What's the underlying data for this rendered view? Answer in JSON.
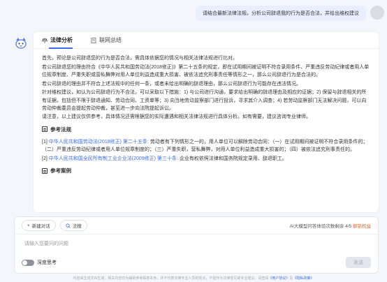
{
  "user_message": "请结合最新法律法规，分析公司辞退我的行为是否合法，并给出维权建议",
  "tabs": [
    {
      "label": "法律分析",
      "active": true
    },
    {
      "label": "联网总结",
      "active": false
    }
  ],
  "analysis": {
    "p1": "首先，预论是公司辞退您的行为是否合法，需具体依据您的情况与相关法律法规进行比对。",
    "p2_prefix": "若公司辞退您的理由符合",
    "p2_law": "《中华人民共和国劳动法(2018修正)》第二十五条",
    "p2_rest": "的规定，即在试用期间被证明不符合录用条件、严重违反劳动纪律或者用人单位规章制度、严重失职或营私舞弊对用人单位利益造成重大损害、被依法追究刑事责任等情形之一，那么公司辞退行为是合法的。",
    "p3": "若公司辞退的理由并不符合上述法规中的任何一条，或者未给出明确的辞退理由，那么公司辞退行为可能存在违法情况。",
    "p4": "针对维权建议，如认为公司辞退行为不合法，可以采取以下措施：1) 与公司进行沟通，要求给出明确的辞退理由及相应的证据；2) 保留与辞退相关的所有证据，包括但不限于辞退通知、劳动合同、工资单等；3) 向当地劳动监察部门进行投诉，寻求其介入调查；4) 若劳动监察部门无法解决问题，可以向劳动仲裁委员会提起劳动仲裁，甚至进一步向法院提起诉讼。",
    "p5": "请注意，以上建议仅供参考，具体情况还需根据您的实际遭遇和相关法律法规进行具体分析。如有需要，建议咨询专业律师。"
  },
  "references": {
    "title": "参考法规",
    "items": [
      {
        "index": "[1]",
        "law": "中华人民共和国劳动法(2018修正) 第二十五条:",
        "text": "劳动者有下列情形之一的，用人单位可以解除劳动合同：（一）在试用期间被证明不符合录用条件的；（二）严重违反劳动纪律或者用人单位规章制度的；（三）严重失职，营私舞弊，对用人单位利益造成重大损害的；（四）被依法追究刑事责任的。"
      },
      {
        "index": "[2]",
        "law": "中华人民共和国全民所有制工业企业法(2009修正) 第三十条:",
        "text": "企业有权依照法律和国务院规定录用、辞退职工。"
      }
    ]
  },
  "cases_title": "参考案例",
  "toolbar": {
    "new_chat": "新建对话",
    "regulations": "法搜",
    "quota_label": "AI大模型问答体验次数剩余 4/5",
    "quota_link": "解锁权益"
  },
  "input": {
    "placeholder": "请输入您要问的问题"
  },
  "deep_think_label": "深度思考",
  "send_label": "发送",
  "disclaimer": {
    "text": "内容由生成式AI生成，相关内容仅为辅助参考解答本身，并不代表法律专业人员的观点，不能作为法律意见或专业建议，请查阅",
    "link1": "《用户协议》",
    "mid": "及",
    "link2": "《隐私政策》"
  },
  "colors": {
    "accent": "#3a6cf4",
    "quota_link": "#e06a2f",
    "background": "#f4f6fb"
  }
}
